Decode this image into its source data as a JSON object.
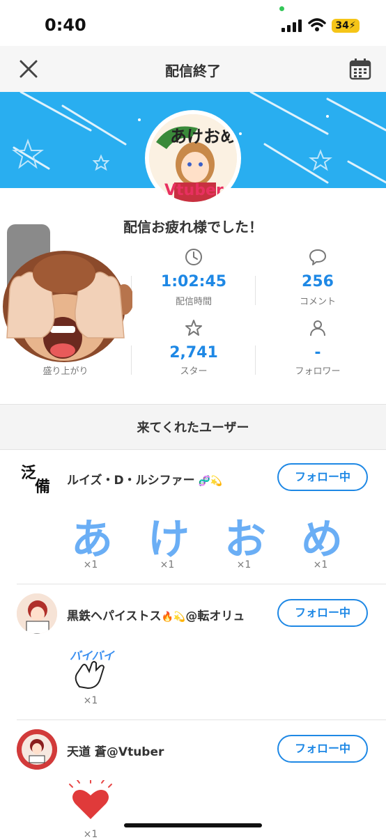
{
  "status_bar": {
    "time": "0:40",
    "battery": "34"
  },
  "nav": {
    "title": "配信終了"
  },
  "summary": {
    "thanks": "配信お疲れ様でした！",
    "stats": {
      "duration": {
        "value": "1:02:45",
        "label": "配信時間"
      },
      "comments": {
        "value": "256",
        "label": "コメント"
      },
      "excitement": {
        "label": "盛り上がり"
      },
      "stars": {
        "value": "2,741",
        "label": "スター"
      },
      "followers": {
        "value": "-",
        "label": "フォロワー"
      }
    }
  },
  "visitors": {
    "title": "来てくれたユーザー",
    "follow_label": "フォロー中",
    "users": [
      {
        "name": "ルイズ・D・ルシファー",
        "stamps": [
          {
            "text": "あ",
            "count": "×1"
          },
          {
            "text": "け",
            "count": "×1"
          },
          {
            "text": "お",
            "count": "×1"
          },
          {
            "text": "め",
            "count": "×1"
          }
        ]
      },
      {
        "name": "黒鉄ヘパイストス",
        "name_suffix": "@転オリュ",
        "stamps": [
          {
            "text": "バイバイ",
            "count": "×1"
          }
        ]
      },
      {
        "name": "天道 蒼@Vtuber",
        "stamps": [
          {
            "text": "",
            "count": "×1"
          }
        ]
      }
    ]
  },
  "colors": {
    "accent": "#1e88e5",
    "banner": "#29aef0",
    "battery": "#f5c518"
  },
  "icons": [
    "close-icon",
    "calendar-icon",
    "clock-icon",
    "comment-icon",
    "star-icon",
    "person-icon",
    "wifi-icon",
    "signal-icon"
  ]
}
